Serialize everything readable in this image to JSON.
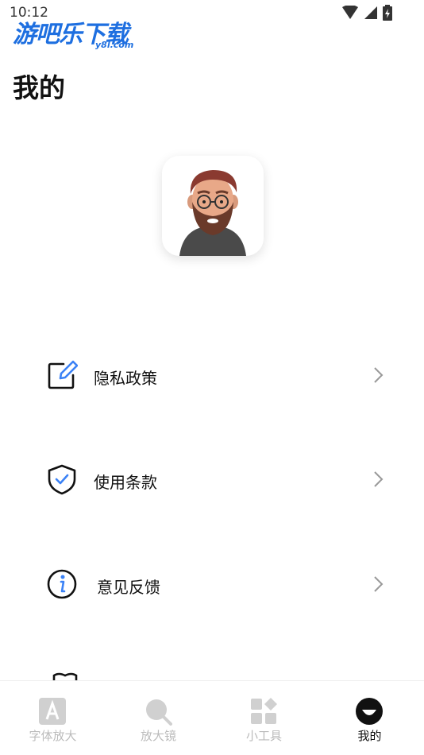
{
  "status_bar": {
    "time": "10:12"
  },
  "watermark": {
    "main": "游吧乐下载",
    "sub": "y8l.com"
  },
  "page": {
    "title": "我的"
  },
  "menu": [
    {
      "label": "隐私政策",
      "icon": "edit-icon"
    },
    {
      "label": "使用条款",
      "icon": "shield-check-icon"
    },
    {
      "label": "意见反馈",
      "icon": "info-icon"
    }
  ],
  "bottom_nav": [
    {
      "label": "字体放大",
      "icon": "font-a-icon",
      "active": false
    },
    {
      "label": "放大镜",
      "icon": "magnifier-icon",
      "active": false
    },
    {
      "label": "小工具",
      "icon": "tools-grid-icon",
      "active": false
    },
    {
      "label": "我的",
      "icon": "profile-icon",
      "active": true
    }
  ],
  "colors": {
    "accent": "#1e6fe0",
    "text": "#111111",
    "nav_inactive": "#bbbbbb"
  }
}
